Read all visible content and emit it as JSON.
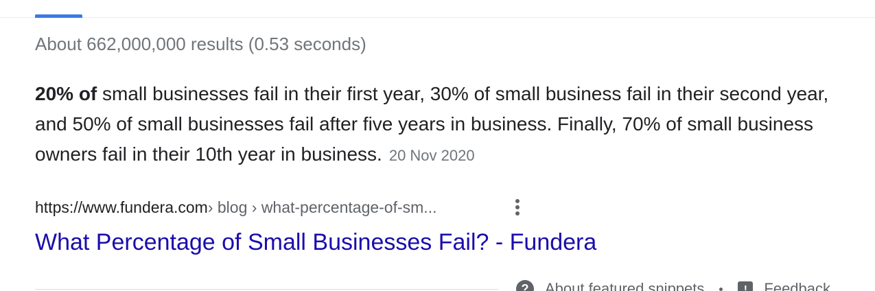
{
  "result_stats": "About 662,000,000 results (0.53 seconds)",
  "featured_snippet": {
    "bold_text": "20% of",
    "text": " small businesses fail in their first year, 30% of small business fail in their second year, and 50% of small businesses fail after five years in business. Finally, 70% of small business owners fail in their 10th year in business.",
    "date": "20 Nov 2020"
  },
  "source": {
    "domain": "https://www.fundera.com",
    "path": " › blog › what-percentage-of-sm...",
    "more_icon": "vertical-dots-icon"
  },
  "result_title": "What Percentage of Small Businesses Fail? - Fundera",
  "footer": {
    "about_label": "About featured snippets",
    "feedback_label": "Feedback",
    "about_icon": "help-circle-icon",
    "feedback_icon": "feedback-icon"
  },
  "colors": {
    "link": "#1a0dab",
    "muted": "#70757a",
    "text": "#202124",
    "tab_indicator": "#3c78e8"
  }
}
